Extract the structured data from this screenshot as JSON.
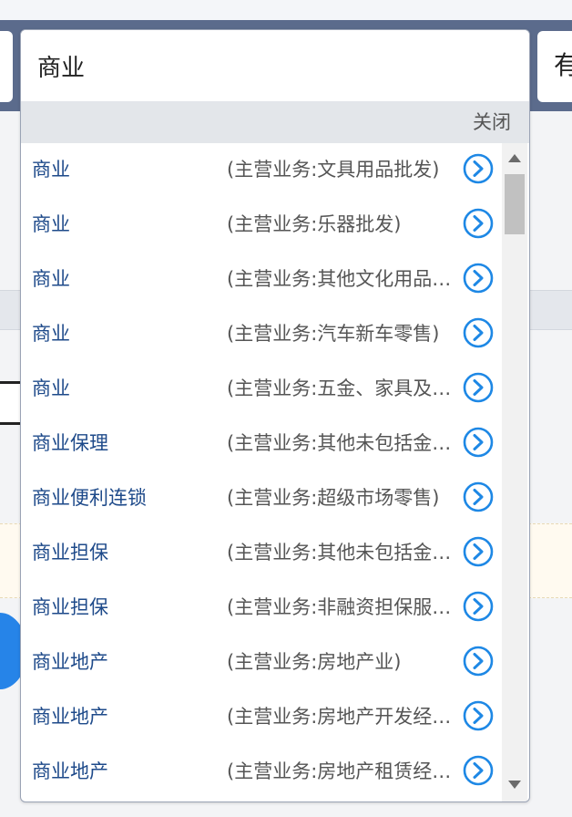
{
  "search": {
    "value": "商业"
  },
  "background": {
    "right_text": "有"
  },
  "dropdown": {
    "close_label": "关闭",
    "items": [
      {
        "name": "商业",
        "desc": "(主营业务:文具用品批发)"
      },
      {
        "name": "商业",
        "desc": "(主营业务:乐器批发)"
      },
      {
        "name": "商业",
        "desc": "(主营业务:其他文化用品批发)"
      },
      {
        "name": "商业",
        "desc": "(主营业务:汽车新车零售)"
      },
      {
        "name": "商业",
        "desc": "(主营业务:五金、家具及室内装饰材料零售)"
      },
      {
        "name": "商业保理",
        "desc": "(主营业务:其他未包括金融业)"
      },
      {
        "name": "商业便利连锁",
        "desc": "(主营业务:超级市场零售)"
      },
      {
        "name": "商业担保",
        "desc": "(主营业务:其他未包括金融业)"
      },
      {
        "name": "商业担保",
        "desc": "(主营业务:非融资担保服务)"
      },
      {
        "name": "商业地产",
        "desc": "(主营业务:房地产业)"
      },
      {
        "name": "商业地产",
        "desc": "(主营业务:房地产开发经营)"
      },
      {
        "name": "商业地产",
        "desc": "(主营业务:房地产租赁经营)"
      }
    ]
  },
  "colors": {
    "accent": "#1e88e5",
    "item_name": "#1e4a8a",
    "header_band": "#5b6b8c"
  },
  "icons": {
    "item_arrow": "chevron-right-circle-icon"
  }
}
